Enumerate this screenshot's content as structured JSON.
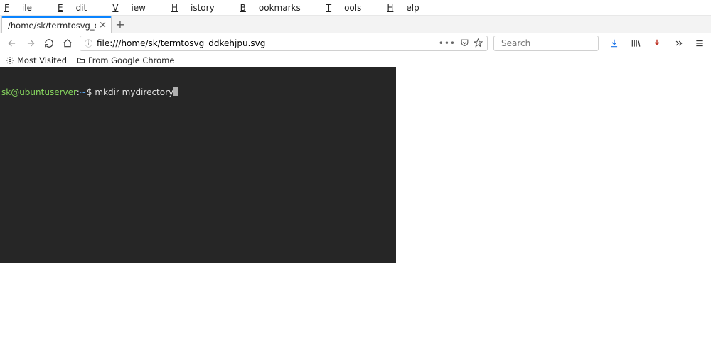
{
  "menu": {
    "file": {
      "u": "F",
      "rest": "ile"
    },
    "edit": {
      "u": "E",
      "rest": "dit"
    },
    "view": {
      "u": "V",
      "rest": "iew"
    },
    "history": {
      "u": "H",
      "rest": "istory"
    },
    "bookmarks": {
      "u": "B",
      "rest": "ookmarks"
    },
    "tools": {
      "u": "T",
      "rest": "ools"
    },
    "help": {
      "u": "H",
      "rest": "elp"
    }
  },
  "tab": {
    "title": "/home/sk/termtosvg_ddkehjp"
  },
  "url": {
    "value": "file:///home/sk/termtosvg_ddkehjpu.svg"
  },
  "search": {
    "placeholder": "Search"
  },
  "bookmarks": {
    "most_visited": "Most Visited",
    "from_chrome": "From Google Chrome"
  },
  "terminal": {
    "user": "sk",
    "at": "@",
    "host": "ubuntuserver",
    "sep": ":",
    "path": "~",
    "ps": "$",
    "command": "mkdir mydirectory"
  }
}
